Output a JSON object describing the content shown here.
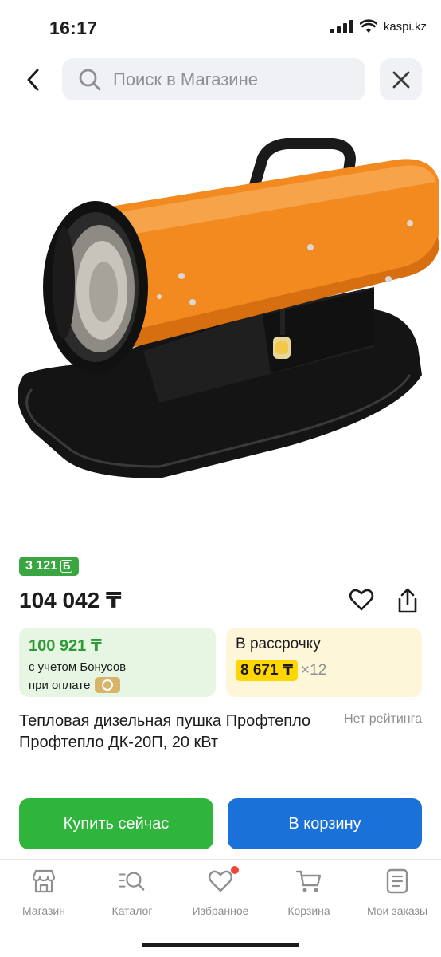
{
  "status_bar": {
    "time": "16:17",
    "domain": "kaspi.kz"
  },
  "search": {
    "placeholder": "Поиск в Магазине"
  },
  "product": {
    "bonus_badge": "3 121",
    "bonus_symbol": "Б",
    "price": "104 042 ₸",
    "bonus_price": "100 921 ₸",
    "bonus_note_1": "с учетом Бонусов",
    "bonus_note_2": "при оплате",
    "installment_label": "В рассрочку",
    "installment_monthly": "8 671 ₸",
    "installment_months": "×12",
    "title": "Тепловая дизельная пушка Профтепло Профтепло ДК-20П, 20 кВт",
    "rating": "Нет рейтинга"
  },
  "actions": {
    "buy_now": "Купить сейчас",
    "add_to_cart": "В корзину"
  },
  "nav": [
    {
      "label": "Магазин",
      "icon": "store-icon"
    },
    {
      "label": "Каталог",
      "icon": "catalog-search-icon"
    },
    {
      "label": "Избранное",
      "icon": "heart-icon",
      "notification_dot": true
    },
    {
      "label": "Корзина",
      "icon": "cart-icon"
    },
    {
      "label": "Мои заказы",
      "icon": "orders-icon"
    }
  ],
  "colors": {
    "green": "#2fb53b",
    "blue": "#1a72d9",
    "yellow": "#ffd600",
    "bonus_badge": "#3aa641",
    "product_orange": "#f28a1f"
  }
}
